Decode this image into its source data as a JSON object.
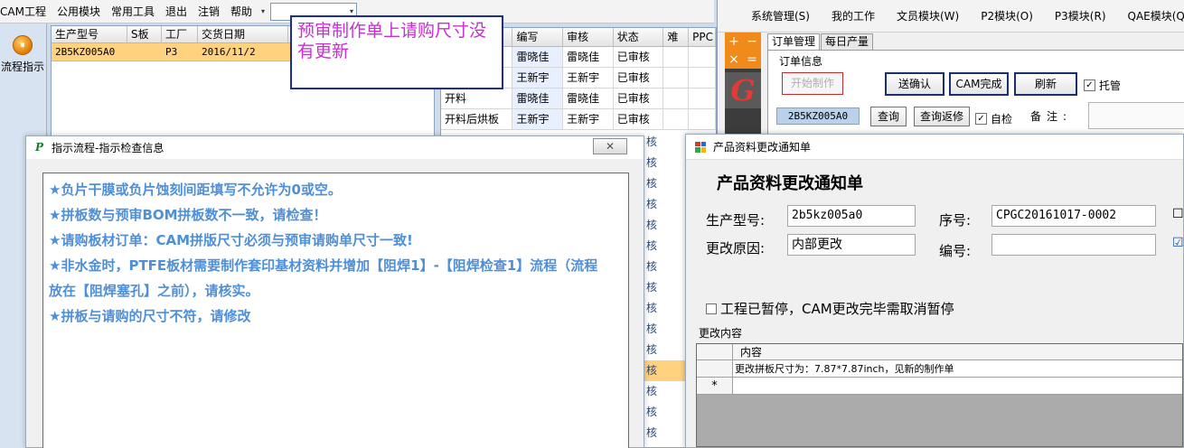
{
  "app_menu": {
    "items": [
      "CAM工程",
      "公用模块",
      "常用工具",
      "退出",
      "注销",
      "帮助"
    ],
    "arrow": "▾",
    "combo_arrow": "▾"
  },
  "left_strip": {
    "flow_button_label": "流程指示"
  },
  "order_list": {
    "columns": [
      "生产型号",
      "S板",
      "工厂",
      "交货日期"
    ],
    "rows": [
      {
        "model": "2B5KZ005A0",
        "s_board": "",
        "factory": "P3",
        "date": "2016/11/2"
      }
    ]
  },
  "tooltip_note": {
    "text": "预审制作单上请购尺寸没有更新"
  },
  "process_grid": {
    "columns": [
      "",
      "编写",
      "审核",
      "状态",
      "难",
      "PPC"
    ],
    "rows": [
      {
        "name": "",
        "writer": "雷晓佳",
        "reviewer": "雷晓佳",
        "status": "已审核"
      },
      {
        "name": "",
        "writer": "王新宇",
        "reviewer": "王新宇",
        "status": "已审核"
      },
      {
        "name": "开料",
        "writer": "雷晓佳",
        "reviewer": "雷晓佳",
        "status": "已审核"
      },
      {
        "name": "开料后烘板",
        "writer": "王新宇",
        "reviewer": "王新宇",
        "status": "已审核"
      }
    ],
    "stub_text": "核"
  },
  "sys_window": {
    "menu": [
      "系统管理(S)",
      "我的工作",
      "文员模块(W)",
      "P2模块(O)",
      "P3模块(R)",
      "QAE模块(Q)"
    ],
    "calc_glyphs": [
      "+",
      "−",
      "×",
      "="
    ],
    "g_glyph": "G",
    "tabs": [
      "订单管理",
      "每日产量"
    ],
    "group_label": "订单信息",
    "buttons": {
      "start": "开始制作",
      "confirm": "送确认",
      "cam_done": "CAM完成",
      "refresh": "刷新",
      "query": "查询",
      "query_return": "查询返修"
    },
    "checkboxes": {
      "custody": "托管",
      "self_check": "自检"
    },
    "order_code": "2B5KZ005A0",
    "remark_label": "备注:"
  },
  "flow_dialog": {
    "title": "指示流程-指示检查信息",
    "icon_glyph": "P",
    "close_glyph": "✕",
    "messages": [
      "★负片干膜或负片蚀刻间距填写不允许为0或空。",
      "★拼板数与预审BOM拼板数不一致，请检查！",
      "★请购板材订单：CAM拼版尺寸必须与预审请购单尺寸一致!",
      "★非水金时，PTFE板材需要制作套印基材资料并增加【阻焊1】-【阻焊检查1】流程（流程",
      "放在【阻焊塞孔】之前），请核实。",
      "★拼板与请购的尺寸不符，请修改"
    ]
  },
  "change_dialog": {
    "title": "产品资料更改通知单",
    "heading": "产品资料更改通知单",
    "fields": {
      "model_label": "生产型号:",
      "model_value": "2b5kz005a0",
      "serial_label": "序号:",
      "serial_value": "CPGC20161017-0002",
      "reason_label": "更改原因:",
      "reason_value": "内部更改",
      "number_label": "编号:",
      "number_value": ""
    },
    "side_checks": [
      "☐",
      "☑"
    ],
    "pause_checkbox": "工程已暂停，CAM更改完毕需取消暂停",
    "content_label": "更改内容",
    "grid": {
      "column": "内容",
      "rows": [
        {
          "marker": "",
          "content": "更改拼板尺寸为：7.87*7.87inch，见新的制作单"
        },
        {
          "marker": "*",
          "content": ""
        }
      ]
    }
  }
}
